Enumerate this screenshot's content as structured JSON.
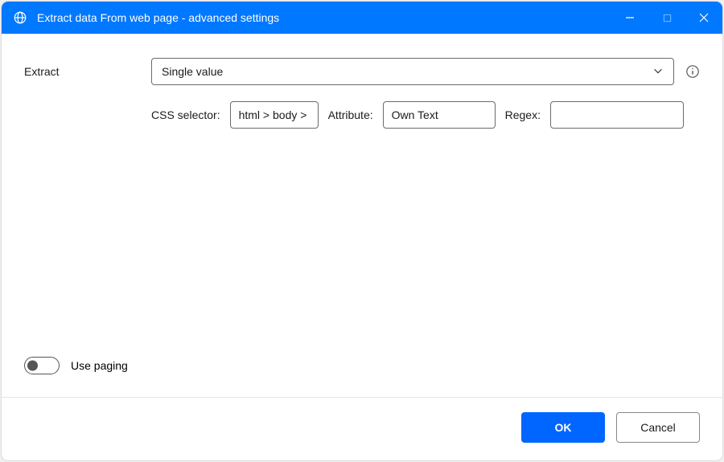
{
  "titlebar": {
    "title": "Extract data From web page - advanced settings"
  },
  "form": {
    "extract_label": "Extract",
    "extract_value": "Single value",
    "css_selector_label": "CSS selector:",
    "css_selector_value": "html > body >",
    "attribute_label": "Attribute:",
    "attribute_value": "Own Text",
    "regex_label": "Regex:",
    "regex_value": "",
    "use_paging_label": "Use paging",
    "use_paging_on": false
  },
  "footer": {
    "ok_label": "OK",
    "cancel_label": "Cancel"
  }
}
